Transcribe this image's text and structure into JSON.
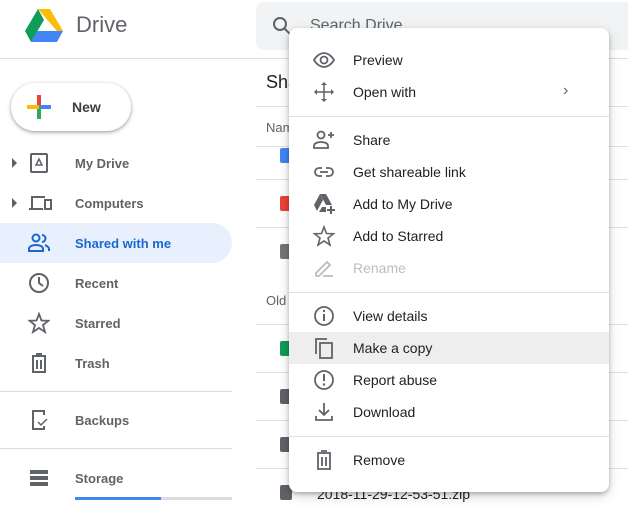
{
  "app": {
    "title": "Drive"
  },
  "search": {
    "placeholder": "Search Drive"
  },
  "sidebar": {
    "new_label": "New",
    "items": [
      {
        "label": "My Drive"
      },
      {
        "label": "Computers"
      },
      {
        "label": "Shared with me",
        "active": true
      },
      {
        "label": "Recent"
      },
      {
        "label": "Starred"
      },
      {
        "label": "Trash"
      },
      {
        "label": "Backups"
      },
      {
        "label": "Storage"
      }
    ],
    "storage_used_fraction": 0.55
  },
  "main": {
    "title": "Sha",
    "name_header": "Nam",
    "older_header": "Old",
    "last_file": "2018-11-29-12-53-51.zip"
  },
  "context_menu": {
    "items": [
      {
        "label": "Preview",
        "icon": "eye-icon"
      },
      {
        "label": "Open with",
        "icon": "move-icon"
      },
      {
        "label": "Share",
        "icon": "person-add-icon"
      },
      {
        "label": "Get shareable link",
        "icon": "link-icon"
      },
      {
        "label": "Add to My Drive",
        "icon": "drive-add-icon"
      },
      {
        "label": "Add to Starred",
        "icon": "star-icon"
      },
      {
        "label": "Rename",
        "icon": "pencil-icon",
        "disabled": true
      },
      {
        "label": "View details",
        "icon": "info-icon"
      },
      {
        "label": "Make a copy",
        "icon": "copy-icon",
        "highlighted": true
      },
      {
        "label": "Report abuse",
        "icon": "alert-icon"
      },
      {
        "label": "Download",
        "icon": "download-icon"
      },
      {
        "label": "Remove",
        "icon": "trash-icon"
      }
    ]
  },
  "colors": {
    "accent": "#1967d2",
    "active_bg": "#e8f0fe",
    "highlight": "#eeeeee"
  }
}
